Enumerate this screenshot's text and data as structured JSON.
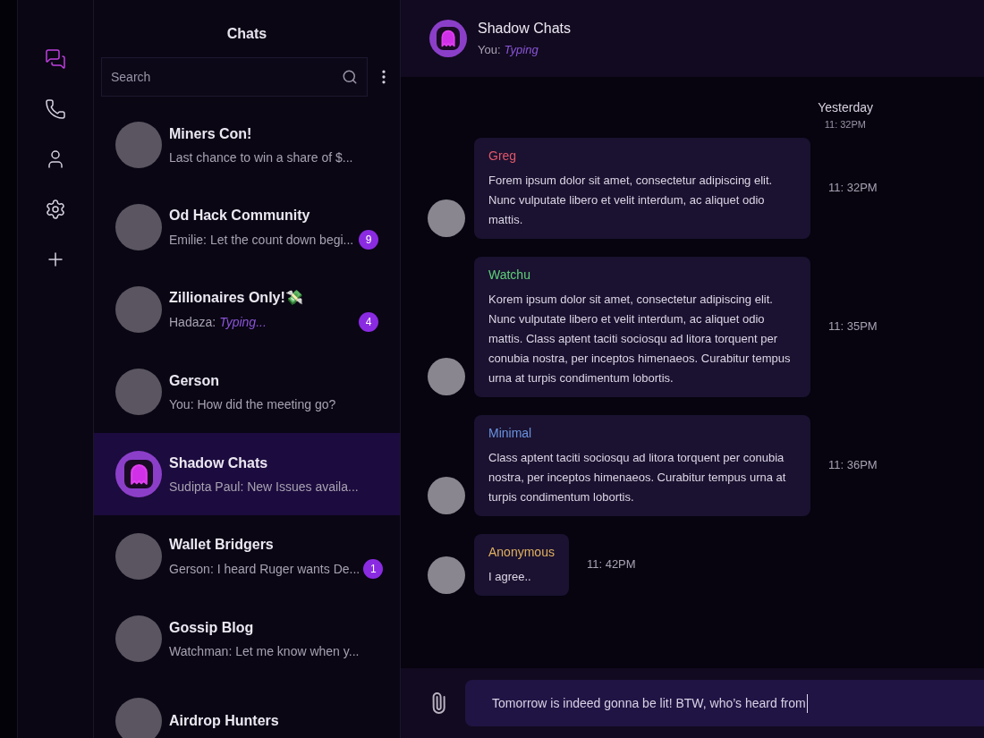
{
  "nav": [
    {
      "kind": "chats",
      "selected": true
    },
    {
      "kind": "calls",
      "selected": false
    },
    {
      "kind": "contacts",
      "selected": false
    },
    {
      "kind": "settings",
      "selected": false
    },
    {
      "kind": "add",
      "selected": false
    }
  ],
  "chat_list": {
    "title": "Chats",
    "search": {
      "placeholder": "Search"
    },
    "items": [
      {
        "name": "Miners Con!",
        "preview": "Last chance to win a share of $...",
        "kind": "photo",
        "selected": false
      },
      {
        "name": "Od Hack Community",
        "preview": "Emilie: Let the count down begi...",
        "unread": "9",
        "kind": "photo",
        "selected": false
      },
      {
        "name": "Zillionaires Only!💸",
        "preview": "Hadaza:",
        "typing": "Typing...",
        "unread": "4",
        "kind": "photo",
        "selected": false
      },
      {
        "name": "Gerson",
        "preview": "You: How did the meeting go?",
        "kind": "photo",
        "selected": false
      },
      {
        "name": "Shadow Chats",
        "preview": "Sudipta Paul: New Issues availa...",
        "kind": "ghost",
        "selected": true
      },
      {
        "name": "Wallet Bridgers",
        "preview": "Gerson: I heard Ruger wants De...",
        "unread": "1",
        "kind": "photo",
        "selected": false
      },
      {
        "name": "Gossip Blog",
        "preview": "Watchman: Let me know when y...",
        "kind": "photo",
        "selected": false
      },
      {
        "name": "Airdrop Hunters",
        "kind": "photo",
        "selected": false
      }
    ]
  },
  "conversation": {
    "title": "Shadow Chats",
    "status_prefix": "You:",
    "status": "Typing",
    "day": "Yesterday",
    "day_time": "11: 32PM",
    "messages": [
      {
        "sender": "Greg",
        "color": "#e0566a",
        "text": "Forem ipsum dolor sit amet, consectetur adipiscing elit. Nunc vulputate libero et velit interdum, ac aliquet odio mattis.",
        "time": "11: 32PM"
      },
      {
        "sender": "Watchu",
        "color": "#5fd07a",
        "text": "Korem ipsum dolor sit amet, consectetur adipiscing elit. Nunc vulputate libero et velit interdum, ac aliquet odio mattis. Class aptent taciti sociosqu ad litora torquent per conubia nostra, per inceptos himenaeos. Curabitur tempus urna at turpis condimentum lobortis.",
        "time": "11: 35PM"
      },
      {
        "sender": "Minimal",
        "color": "#6a93e0",
        "text": "Class aptent taciti sociosqu ad litora torquent per conubia nostra, per inceptos himenaeos. Curabitur tempus urna at turpis condimentum lobortis.",
        "time": "11: 36PM"
      },
      {
        "sender": "Anonymous",
        "color": "#e0b060",
        "text": "I agree..",
        "time": "11: 42PM"
      }
    ],
    "composer": {
      "value": "Tomorrow is indeed gonna be lit! BTW, who’s heard from"
    }
  }
}
